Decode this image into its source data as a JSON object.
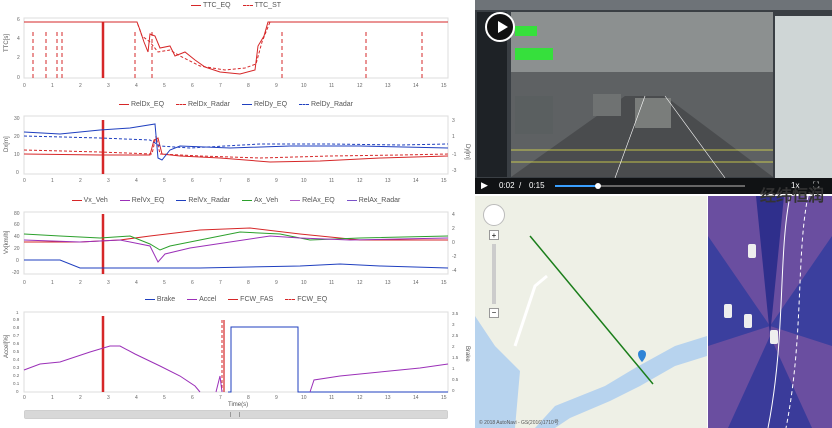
{
  "chart1": {
    "legend": [
      "TTC_EQ",
      "TTC_ST"
    ],
    "ylabel": "TTC[s]",
    "yticks": [
      "0",
      "2",
      "4",
      "6"
    ],
    "xticks": [
      "0",
      "1",
      "2",
      "3",
      "4",
      "5",
      "6",
      "7",
      "8",
      "9",
      "10",
      "11",
      "12",
      "13",
      "14",
      "15"
    ]
  },
  "chart2": {
    "legend": [
      "RelDx_EQ",
      "RelDx_Radar",
      "RelDy_EQ",
      "RelDy_Radar"
    ],
    "ylabel_left": "Dx[m]",
    "ylabel_right": "Dy[m]",
    "yticks_left": [
      "0",
      "10",
      "20",
      "30"
    ],
    "yticks_right": [
      "-3",
      "-1",
      "1",
      "3"
    ],
    "xticks": [
      "0",
      "1",
      "2",
      "3",
      "4",
      "5",
      "6",
      "7",
      "8",
      "9",
      "10",
      "11",
      "12",
      "13",
      "14",
      "15"
    ]
  },
  "chart3": {
    "legend": [
      "Vx_Veh",
      "RelVx_EQ",
      "RelVx_Radar",
      "Ax_Veh",
      "RelAx_EQ",
      "RelAx_Radar"
    ],
    "ylabel_left": "Vx[km/h]",
    "yticks_left": [
      "-20",
      "0",
      "20",
      "40",
      "60",
      "80"
    ],
    "yticks_right": [
      "-4",
      "-2",
      "0",
      "2",
      "4"
    ],
    "xticks": [
      "0",
      "1",
      "2",
      "3",
      "4",
      "5",
      "6",
      "7",
      "8",
      "9",
      "10",
      "11",
      "12",
      "13",
      "14",
      "15"
    ]
  },
  "chart4": {
    "legend": [
      "Brake",
      "Accel",
      "FCW_FAS",
      "FCW_EQ"
    ],
    "ylabel_left": "Accel[%]",
    "ylabel_right": "Brake",
    "yticks_left": [
      "0",
      "0.1",
      "0.2",
      "0.3",
      "0.4",
      "0.5",
      "0.6",
      "0.7",
      "0.8",
      "0.9",
      "1"
    ],
    "yticks_right": [
      "0",
      "0.5",
      "1",
      "1.5",
      "2",
      "2.5",
      "3",
      "3.5"
    ],
    "xticks": [
      "0",
      "1",
      "2",
      "3",
      "4",
      "5",
      "6",
      "7",
      "8",
      "9",
      "10",
      "11",
      "12",
      "13",
      "14",
      "15"
    ],
    "xlabel": "Time(s)"
  },
  "video": {
    "elapsed": "0:02",
    "separator": "/",
    "duration": "0:15",
    "speed": "1x"
  },
  "map": {
    "copyright": "© 2018 AutoNavi - GS(2016)1710号"
  },
  "watermark": "经纬恒润",
  "colors": {
    "red": "#d62728",
    "blue": "#1f3fbf",
    "green": "#2ca02c",
    "purple": "#9b30b8"
  }
}
